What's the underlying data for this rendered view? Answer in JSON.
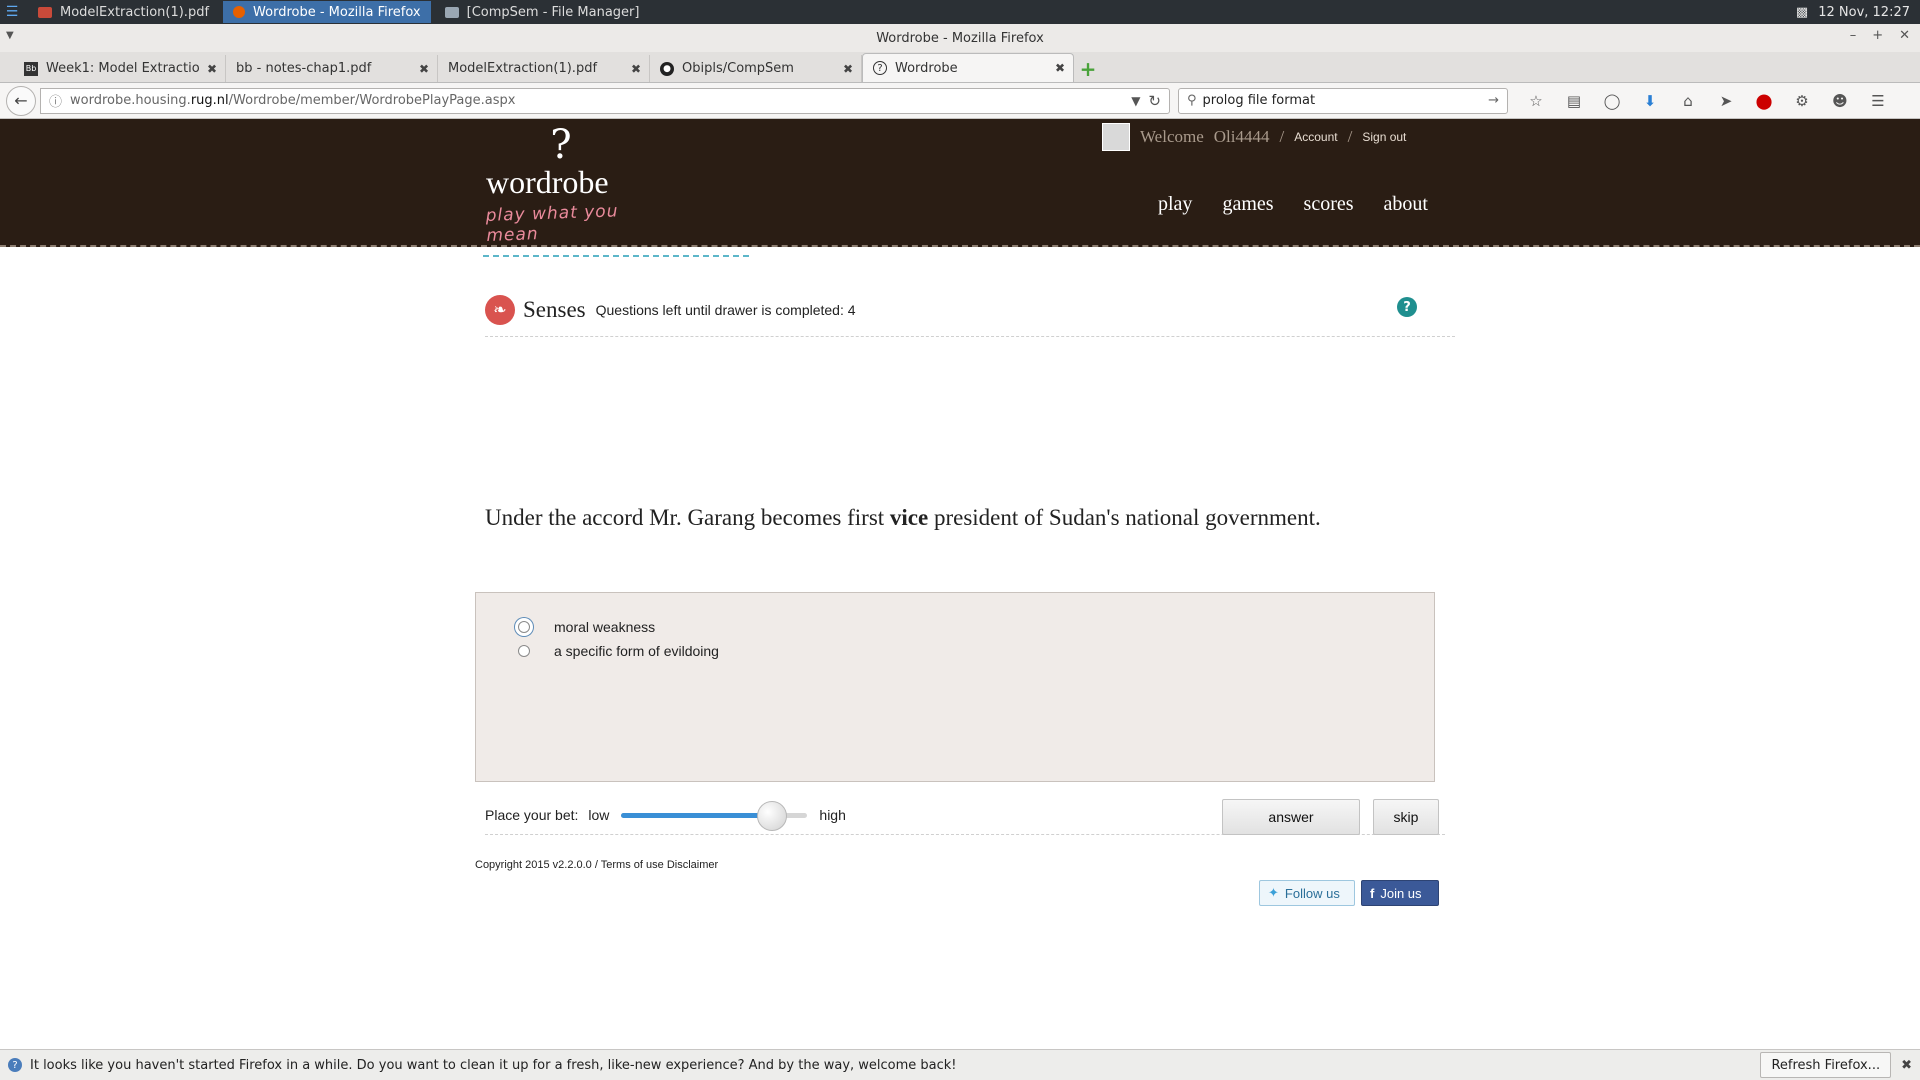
{
  "taskbar": {
    "tasks": [
      {
        "label": "ModelExtraction(1).pdf"
      },
      {
        "label": "Wordrobe - Mozilla Firefox"
      },
      {
        "label": "[CompSem - File Manager]"
      }
    ],
    "clock": "12 Nov, 12:27"
  },
  "window": {
    "title": "Wordrobe - Mozilla Firefox"
  },
  "tabs": [
    {
      "label": "Week1: Model Extractio..."
    },
    {
      "label": "bb - notes-chap1.pdf"
    },
    {
      "label": "ModelExtraction(1).pdf"
    },
    {
      "label": "Obipls/CompSem"
    },
    {
      "label": "Wordrobe"
    }
  ],
  "navbar": {
    "url_prefix": "wordrobe.housing.",
    "url_domain": "rug.nl",
    "url_path": "/Wordrobe/member/WordrobePlayPage.aspx",
    "search_value": "prolog file format"
  },
  "site": {
    "logo_mark": "?",
    "logo_name": "wordrobe",
    "logo_tagline": "play what you mean",
    "welcome": "Welcome",
    "username": "Oli4444",
    "account": "Account",
    "signout": "Sign out",
    "nav": [
      "play",
      "games",
      "scores",
      "about"
    ]
  },
  "game": {
    "drawer_name": "Senses",
    "questions_left_label": "Questions left until drawer is completed:",
    "questions_left": "4",
    "sentence_before": "Under the accord Mr. Garang becomes first ",
    "sentence_target": "vice",
    "sentence_after": " president of Sudan's national government.",
    "options": [
      {
        "label": "moral weakness"
      },
      {
        "label": "a specific form of evildoing"
      }
    ],
    "bet_label": "Place your bet:",
    "bet_low": "low",
    "bet_high": "high",
    "bet_level": 0.87,
    "answer_label": "answer",
    "skip_label": "skip"
  },
  "footer": {
    "copyright": "Copyright 2015 v2.2.0.0 /",
    "terms": "Terms of use",
    "disclaimer": "Disclaimer",
    "follow": "Follow us",
    "join": "Join us"
  },
  "notification": {
    "message": "It looks like you haven't started Firefox in a while. Do you want to clean it up for a fresh, like-new experience? And by the way, welcome back!",
    "button": "Refresh Firefox..."
  },
  "colors": {
    "header_bg": "#2a1d14",
    "accent_red": "#d9534f",
    "slider_blue": "#3a8fd6",
    "help_teal": "#1f8f8f"
  }
}
